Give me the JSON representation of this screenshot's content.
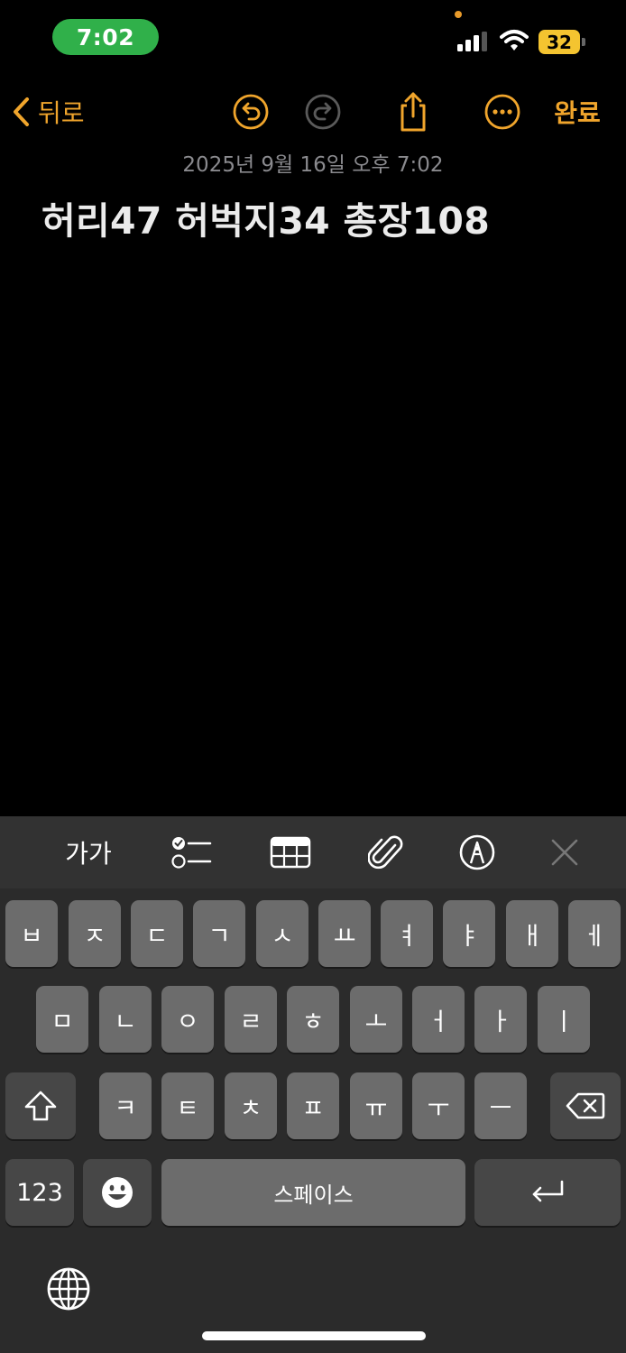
{
  "status_bar": {
    "time": "7:02",
    "battery": "32",
    "icons": [
      "cellular-signal-icon",
      "wifi-icon",
      "battery-icon"
    ]
  },
  "nav": {
    "back_label": "뒤로",
    "done_label": "완료",
    "icons": [
      "chevron-left-icon",
      "undo-icon",
      "redo-icon",
      "share-icon",
      "more-icon"
    ]
  },
  "note": {
    "date": "2025년 9월 16일 오후 7:02",
    "title": "허리47 허벅지34 총장108"
  },
  "keyboard": {
    "toolbar": {
      "format_label": "가가",
      "icons": [
        "checklist-icon",
        "table-icon",
        "attachment-icon",
        "markup-icon",
        "close-icon"
      ]
    },
    "row1": [
      "ㅂ",
      "ㅈ",
      "ㄷ",
      "ㄱ",
      "ㅅ",
      "ㅛ",
      "ㅕ",
      "ㅑ",
      "ㅐ",
      "ㅔ"
    ],
    "row2": [
      "ㅁ",
      "ㄴ",
      "ㅇ",
      "ㄹ",
      "ㅎ",
      "ㅗ",
      "ㅓ",
      "ㅏ",
      "ㅣ"
    ],
    "row3": [
      "ㅋ",
      "ㅌ",
      "ㅊ",
      "ㅍ",
      "ㅠ",
      "ㅜ",
      "ㅡ"
    ],
    "numbers_label": "123",
    "space_label": "스페이스",
    "icons": [
      "shift-icon",
      "delete-icon",
      "emoji-icon",
      "return-icon",
      "globe-icon"
    ]
  },
  "colors": {
    "accent": "#f0a52c",
    "time_pill": "#30b04a",
    "battery": "#f4c430",
    "key": "#6c6c6c",
    "key_dark": "#474747",
    "keyboard_bg": "#2b2b2b"
  }
}
